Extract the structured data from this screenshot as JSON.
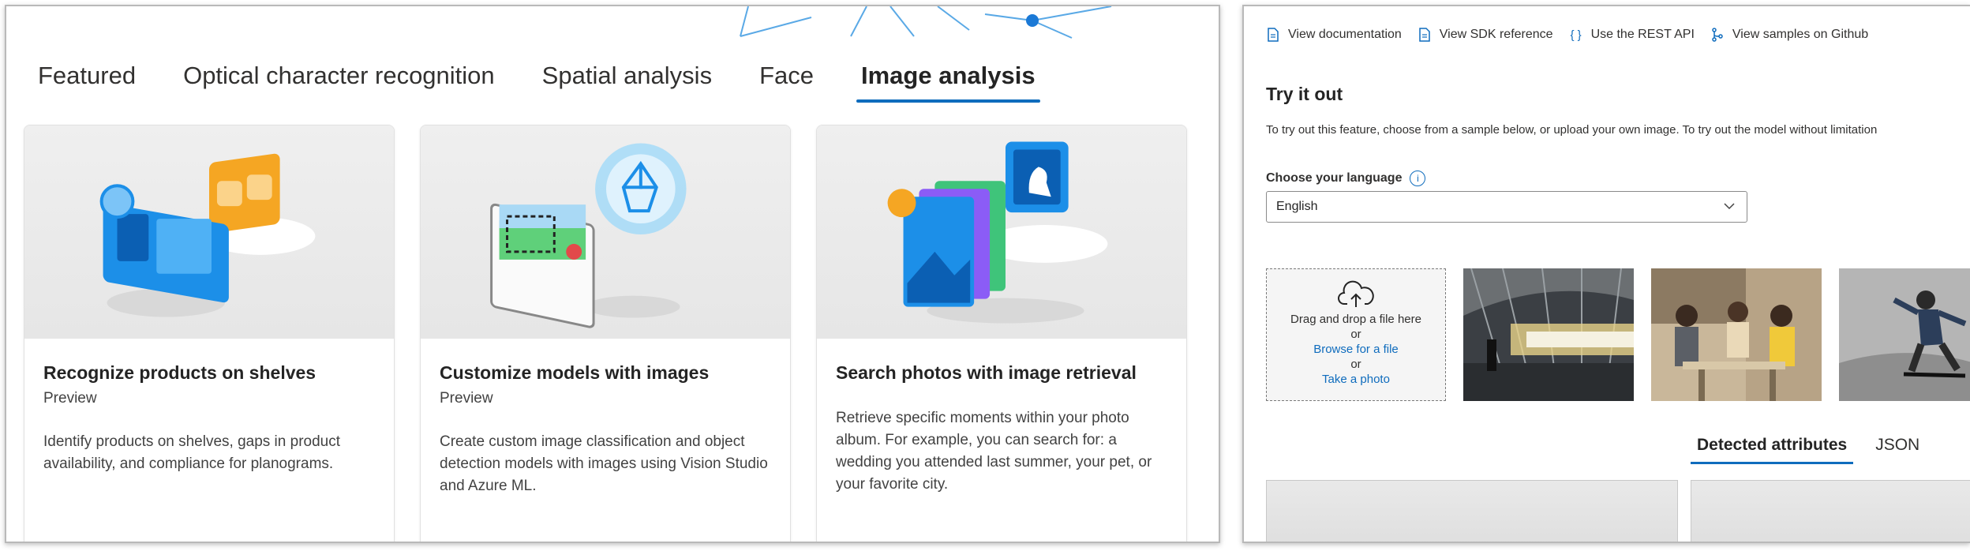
{
  "left": {
    "tabs": [
      {
        "label": "Featured"
      },
      {
        "label": "Optical character recognition"
      },
      {
        "label": "Spatial analysis"
      },
      {
        "label": "Face"
      },
      {
        "label": "Image analysis"
      }
    ],
    "active_tab": "Image analysis",
    "cards": [
      {
        "title": "Recognize products on shelves",
        "subtitle": "Preview",
        "description": "Identify products on shelves, gaps in product availability, and compliance for planograms."
      },
      {
        "title": "Customize models with images",
        "subtitle": "Preview",
        "description": "Create custom image classification and object detection models with images using Vision Studio and Azure ML."
      },
      {
        "title": "Search photos with image retrieval",
        "subtitle": "",
        "description": "Retrieve specific moments within your photo album. For example, you can search for: a wedding you attended last summer, your pet, or your favorite city."
      }
    ]
  },
  "right": {
    "links": [
      {
        "label": "View documentation",
        "icon": "document-icon"
      },
      {
        "label": "View SDK reference",
        "icon": "document-icon"
      },
      {
        "label": "Use the REST API",
        "icon": "braces-icon"
      },
      {
        "label": "View samples on Github",
        "icon": "branch-icon"
      }
    ],
    "try_title": "Try it out",
    "try_description": "To try out this feature, choose from a sample below, or upload your own image. To try out the model without limitation",
    "language_label": "Choose your language",
    "language_value": "English",
    "dropzone": {
      "line1": "Drag and drop a file here",
      "or1": "or",
      "browse": "Browse for a file",
      "or2": "or",
      "photo": "Take a photo"
    },
    "result_tabs": [
      {
        "label": "Detected attributes"
      },
      {
        "label": "JSON"
      }
    ],
    "active_result_tab": "Detected attributes"
  },
  "colors": {
    "accent": "#0f6cbd",
    "text": "#242424"
  }
}
